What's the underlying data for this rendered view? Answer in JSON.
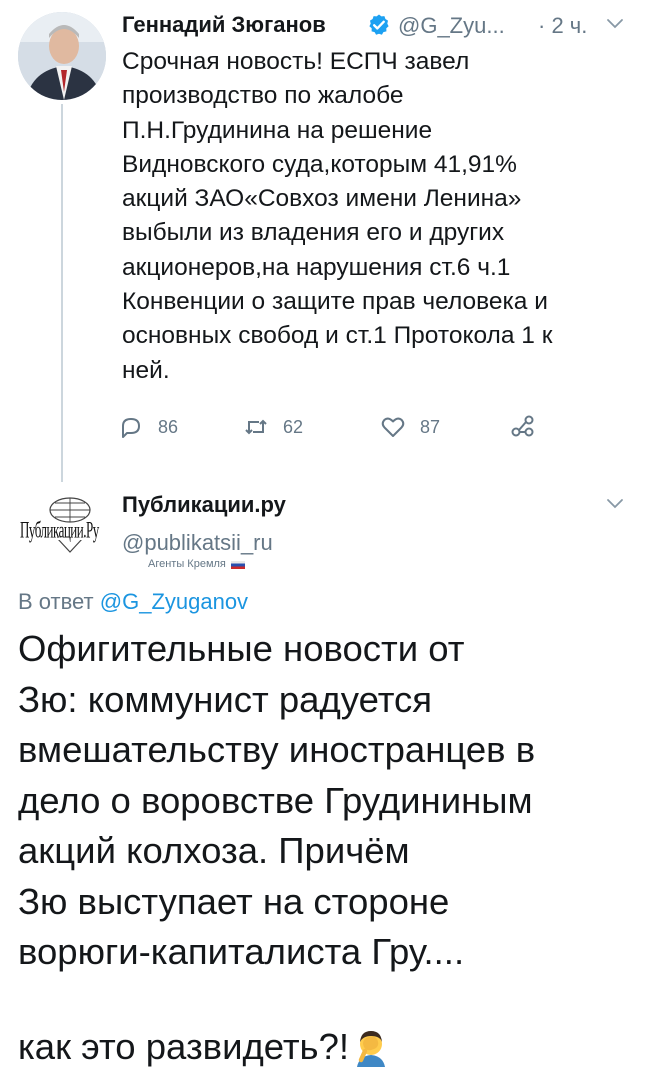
{
  "tweet1": {
    "author_name": "Геннадий Зюганов",
    "author_handle": "@G_Zyu...",
    "time": "· 2 ч.",
    "text": "Срочная новость! ЕСПЧ завел\nпроизводство по жалобе\nП.Н.Грудинина на решение\nВидновского суда,которым 41,91%\nакций ЗАО«Совхоз имени Ленина»\nвыбыли из владения его и других\nакционеров,на нарушения ст.6 ч.1\nКонвенции о защите прав человека и\nосновных свобод и ст.1 Протокола 1 к\nней.",
    "replies": "86",
    "retweets": "62",
    "likes": "87"
  },
  "tweet2": {
    "author_name": "Публикации.ру",
    "author_handle": "@publikatsii_ru",
    "account_label": "Агенты Кремля",
    "avatar_logo_text": "Публикации.Ру",
    "replying_prefix": "В ответ",
    "replying_to": "@G_Zyuganov",
    "text": "Офигительные новости от\nЗю: коммунист радуется\nвмешательству иностранцев в\nдело о воровстве Грудининым\nакций колхоза. Причём\nЗю выступает на стороне\nворюги-капиталиста Гру....",
    "last_line": "как это развидеть?!"
  },
  "colors": {
    "text": "#14171a",
    "secondary": "#657786",
    "link": "#1b95e0",
    "verified": "#1da1f2",
    "divider": "#ccd6dd"
  },
  "icons": [
    "verified-badge-icon",
    "chevron-down-icon",
    "reply-icon",
    "retweet-icon",
    "like-icon",
    "share-icon",
    "facepalm-emoji-icon"
  ]
}
